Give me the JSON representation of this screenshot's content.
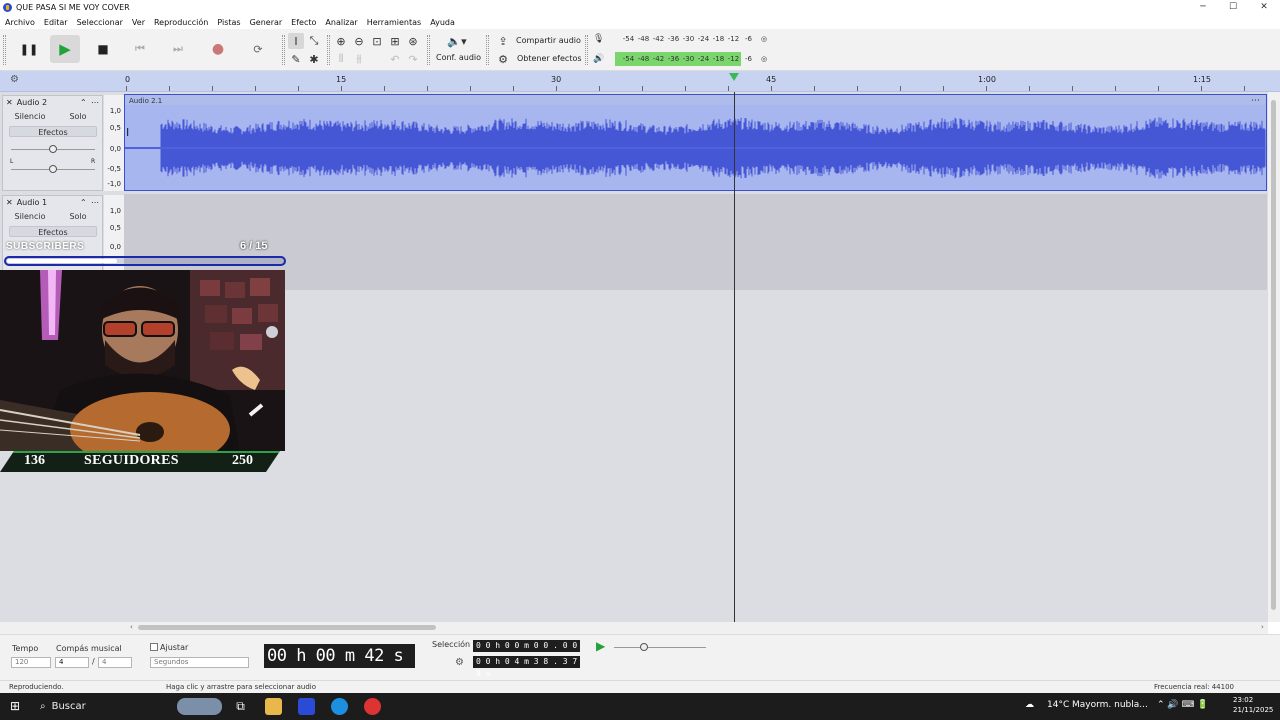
{
  "window": {
    "title": "QUE PASA SI ME VOY COVER",
    "controls": {
      "minimize": "─",
      "maximize": "☐",
      "close": "✕"
    }
  },
  "menu": [
    "Archivo",
    "Editar",
    "Seleccionar",
    "Ver",
    "Reproducción",
    "Pistas",
    "Generar",
    "Efecto",
    "Analizar",
    "Herramientas",
    "Ayuda"
  ],
  "toolbar": {
    "conf_audio": "Conf. audio",
    "share_audio": "Compartir audio",
    "get_effects": "Obtener efectos",
    "meter_scale": [
      "-54",
      "-48",
      "-42",
      "-36",
      "-30",
      "-24",
      "-18",
      "-12",
      "-6"
    ],
    "meter_channels": [
      "L",
      "R"
    ]
  },
  "ruler": {
    "labels": [
      "0",
      "15",
      "30",
      "45",
      "1:00",
      "1:15"
    ]
  },
  "tracks": [
    {
      "name": "Audio 2",
      "mute": "Silencio",
      "solo": "Solo",
      "effects": "Efectos",
      "pan_left": "L",
      "pan_right": "R",
      "clip_name": "Audio 2.1",
      "scale": [
        "1,0",
        "0,5",
        "0,0",
        "-0,5",
        "-1,0"
      ]
    },
    {
      "name": "Audio 1",
      "mute": "Silencio",
      "solo": "Solo",
      "effects": "Efectos",
      "scale": [
        "1,0",
        "0,5",
        "0,0"
      ]
    }
  ],
  "overlay": {
    "subscribers_label": "SUBSCRIBERS",
    "subscribers_count": "6 / 15",
    "subscribers_progress": 0.4,
    "followers_current": "136",
    "followers_label": "SEGUIDORES",
    "followers_goal": "250"
  },
  "bottom": {
    "tempo_label": "Tempo",
    "tempo_value": "120",
    "time_sig_label": "Compás musical",
    "time_sig_num": "4",
    "time_sig_den": "4",
    "snap_label": "Ajustar",
    "snap_unit": "Segundos",
    "audio_position": "00 h 00 m 42 s",
    "selection_label": "Selección",
    "selection_start": "0 0 h 0 0 m 0 0 . 0 0 0 s",
    "selection_end": "0 0 h 0 4 m 3 8 . 3 7 9 s"
  },
  "status": {
    "left": "Reproduciendo.",
    "hint": "Haga clic y arrastre para seleccionar audio",
    "rate": "Frecuencia real: 44100"
  },
  "taskbar": {
    "search": "Buscar",
    "temperature": "14°C",
    "weather": "Mayorm. nubla...",
    "time": "23:02",
    "date": "21/11/2025"
  }
}
